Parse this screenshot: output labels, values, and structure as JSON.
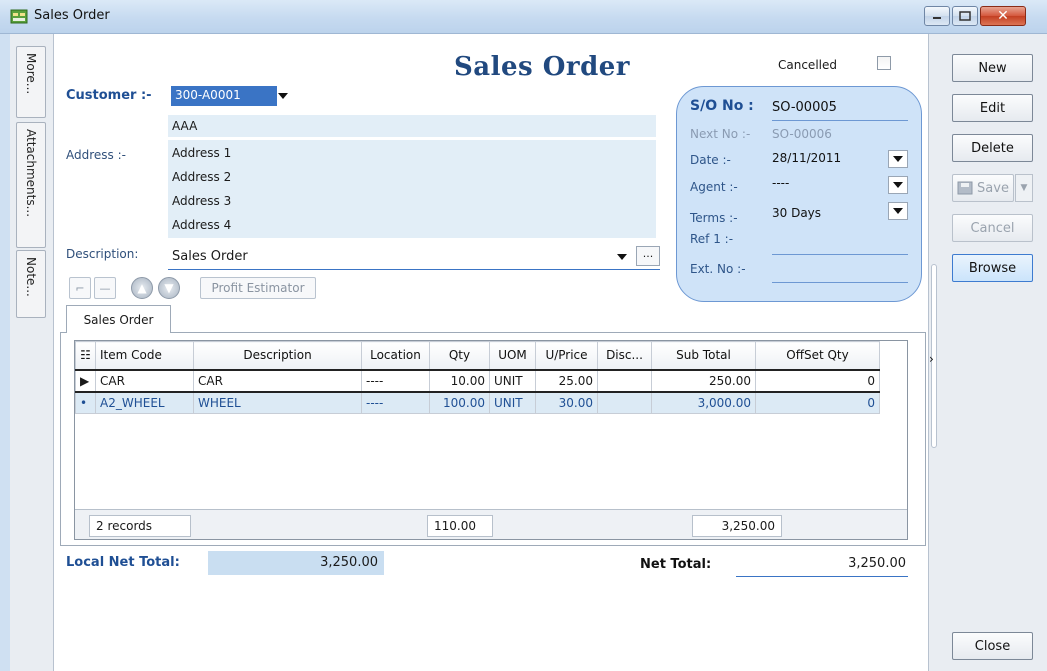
{
  "window": {
    "title": "Sales Order",
    "min_icon": "minimize-icon",
    "max_icon": "maximize-icon",
    "close_icon": "close-icon"
  },
  "side_tabs": [
    "More...",
    "Attachments...",
    "Note..."
  ],
  "form": {
    "heading": "Sales Order",
    "cancelled_label": "Cancelled",
    "cancelled": false,
    "customer_label": "Customer :-",
    "customer_code": "300-A0001",
    "customer_name": "AAA",
    "address_label": "Address :-",
    "address_lines": [
      "Address 1",
      "Address 2",
      "Address 3",
      "Address 4"
    ],
    "description_label": "Description:",
    "description_value": "Sales Order",
    "more_label": "···"
  },
  "toolbar": {
    "profit_estimator": "Profit Estimator"
  },
  "so_panel": {
    "so_no_label": "S/O No :",
    "so_no": "SO-00005",
    "next_no_label": "Next No :-",
    "next_no": "SO-00006",
    "date_label": "Date :-",
    "date": "28/11/2011",
    "agent_label": "Agent :-",
    "agent": "----",
    "terms_label": "Terms :-",
    "terms": "30 Days",
    "ref1_label": "Ref 1 :-",
    "ref1": "",
    "ext_no_label": "Ext. No :-",
    "ext_no": ""
  },
  "tab": {
    "label": "Sales Order"
  },
  "grid": {
    "columns": [
      "Item Code",
      "Description",
      "Location",
      "Qty",
      "UOM",
      "U/Price",
      "Disc...",
      "Sub Total",
      "OffSet Qty"
    ],
    "rows": [
      {
        "marker": "▶",
        "item_code": "CAR",
        "description": "CAR",
        "location": "----",
        "qty": "10.00",
        "uom": "UNIT",
        "price": "25.00",
        "disc": "",
        "subtotal": "250.00",
        "offset": "0"
      },
      {
        "marker": "•",
        "item_code": "A2_WHEEL",
        "description": "WHEEL",
        "location": "----",
        "qty": "100.00",
        "uom": "UNIT",
        "price": "30.00",
        "disc": "",
        "subtotal": "3,000.00",
        "offset": "0"
      }
    ],
    "footer": {
      "records": "2 records",
      "qty_total": "110.00",
      "subtotal_total": "3,250.00"
    }
  },
  "totals": {
    "local_label": "Local Net Total:",
    "local_value": "3,250.00",
    "net_label": "Net Total:",
    "net_value": "3,250.00"
  },
  "buttons": {
    "new": "New",
    "edit": "Edit",
    "delete": "Delete",
    "save": "Save",
    "cancel": "Cancel",
    "browse": "Browse",
    "close": "Close"
  },
  "colors": {
    "accent": "#1f4f94",
    "panel": "#cfe3f8",
    "selection": "#3a74c5"
  }
}
